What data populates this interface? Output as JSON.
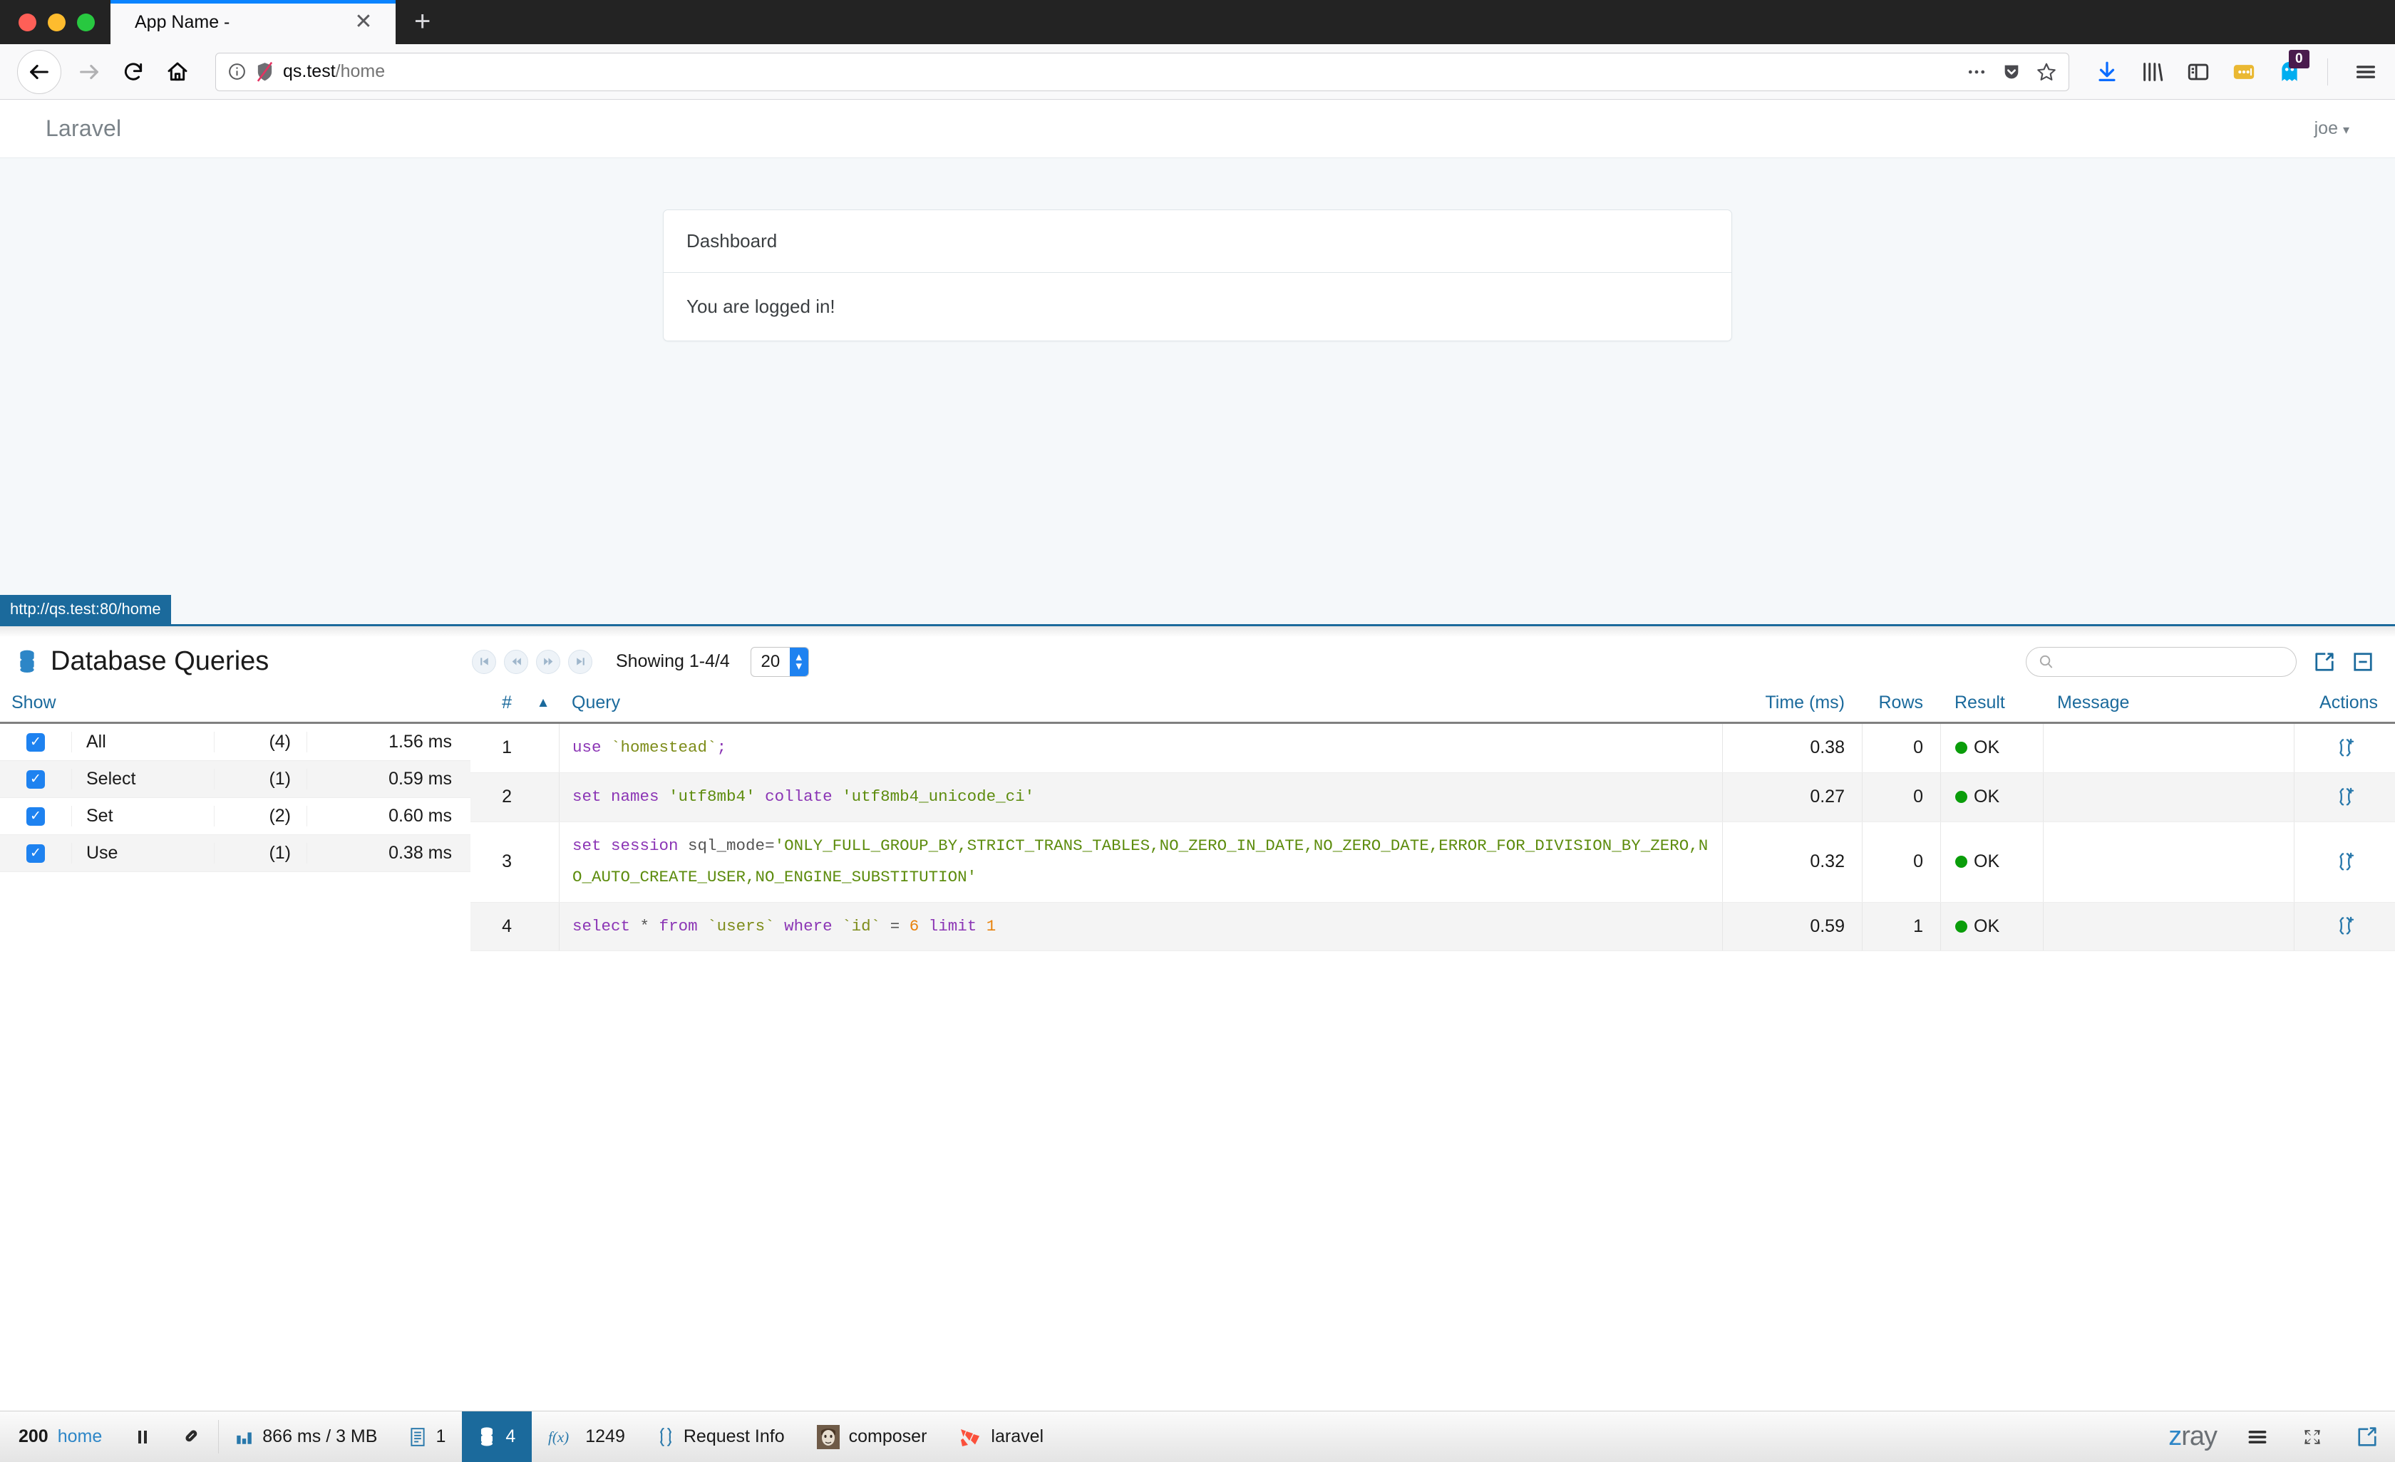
{
  "browser": {
    "tab": {
      "title": "App Name -",
      "close_label": "✕"
    },
    "newtab_label": "+",
    "url": {
      "host": "qs.test",
      "path": "/home",
      "full": "qs.test/home"
    },
    "toolbar_icons": [
      "downloads-icon",
      "library-icon",
      "sidebar-icon",
      "pocket-icon",
      "ghostery-icon",
      "menu-icon"
    ],
    "ghostery_badge": "0",
    "nav_icons": [
      "back-icon",
      "forward-icon",
      "reload-icon",
      "home-icon"
    ],
    "url_icons": [
      "info-icon",
      "tracking-protection-icon",
      "page-actions-icon",
      "pocket-save-icon",
      "bookmark-star-icon"
    ]
  },
  "app": {
    "brand": "Laravel",
    "user": "joe",
    "card": {
      "header": "Dashboard",
      "body": "You are logged in!"
    }
  },
  "status_tooltip": "http://qs.test:80/home",
  "zray": {
    "panel_title": "Database Queries",
    "pager": {
      "first": "first-page-icon",
      "prev": "prev-page-icon",
      "next": "next-page-icon",
      "last": "last-page-icon",
      "showing": "Showing 1-4/4",
      "per_page": "20"
    },
    "search": {
      "value": "",
      "placeholder": ""
    },
    "header_actions": [
      "open-in-new-window-icon",
      "collapse-panel-icon"
    ],
    "filters": {
      "header": "Show",
      "rows": [
        {
          "checked": true,
          "label": "All",
          "count": "(4)",
          "time": "1.56 ms"
        },
        {
          "checked": true,
          "label": "Select",
          "count": "(1)",
          "time": "0.59 ms"
        },
        {
          "checked": true,
          "label": "Set",
          "count": "(2)",
          "time": "0.60 ms"
        },
        {
          "checked": true,
          "label": "Use",
          "count": "(1)",
          "time": "0.38 ms"
        }
      ]
    },
    "table": {
      "columns": {
        "num": "#",
        "sort": "sort-asc-icon",
        "query": "Query",
        "time": "Time (ms)",
        "rows": "Rows",
        "result": "Result",
        "message": "Message",
        "actions": "Actions"
      },
      "rows": [
        {
          "num": "1",
          "query_plain": "use `homestead`;",
          "time": "0.38",
          "rows": "0",
          "result": "OK",
          "message": "",
          "action_icon": "copy-query-icon"
        },
        {
          "num": "2",
          "query_plain": "set names 'utf8mb4' collate 'utf8mb4_unicode_ci'",
          "time": "0.27",
          "rows": "0",
          "result": "OK",
          "message": "",
          "action_icon": "copy-query-icon"
        },
        {
          "num": "3",
          "query_plain": "set session sql_mode='ONLY_FULL_GROUP_BY,STRICT_TRANS_TABLES,NO_ZERO_IN_DATE,NO_ZERO_DATE,ERROR_FOR_DIVISION_BY_ZERO,NO_AUTO_CREATE_USER,NO_ENGINE_SUBSTITUTION'",
          "time": "0.32",
          "rows": "0",
          "result": "OK",
          "message": "",
          "action_icon": "copy-query-icon"
        },
        {
          "num": "4",
          "query_plain": "select * from `users` where `id` = 6 limit 1",
          "time": "0.59",
          "rows": "1",
          "result": "OK",
          "message": "",
          "action_icon": "copy-query-icon"
        }
      ]
    },
    "statusbar": {
      "http_status": "200",
      "route": "home",
      "pause_icon": "pause-icon",
      "pill_icon": "capsule-icon",
      "perf_icon": "bar-chart-icon",
      "perf": "866 ms / 3 MB",
      "log_icon": "log-icon",
      "log_count": "1",
      "db_icon": "database-icon",
      "db_count": "4",
      "fn_icon": "function-icon",
      "fn_count": "1249",
      "request_icon": "braces-icon",
      "request_label": "Request Info",
      "composer_icon": "composer-icon",
      "composer_label": "composer",
      "laravel_icon": "laravel-icon",
      "laravel_label": "laravel",
      "logo_z": "z",
      "logo_rest": "ray",
      "menu_icon": "hamburger-icon",
      "collapse_icon": "collapse-icon",
      "popout_icon": "popout-icon"
    }
  },
  "colors": {
    "accent": "#1b6a9c",
    "checkbox": "#1e82f0",
    "ok": "#0a9d0a",
    "tab_active": "#0a84ff"
  }
}
